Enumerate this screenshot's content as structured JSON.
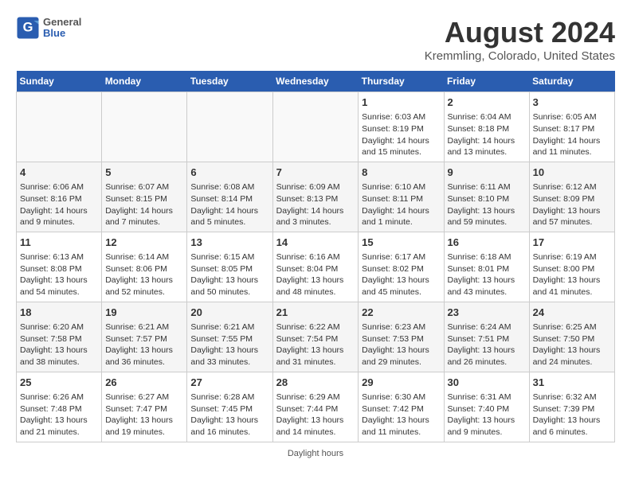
{
  "header": {
    "logo_general": "General",
    "logo_blue": "Blue",
    "month_year": "August 2024",
    "location": "Kremmling, Colorado, United States"
  },
  "days_of_week": [
    "Sunday",
    "Monday",
    "Tuesday",
    "Wednesday",
    "Thursday",
    "Friday",
    "Saturday"
  ],
  "footer": "Daylight hours",
  "weeks": [
    [
      {
        "day": "",
        "info": ""
      },
      {
        "day": "",
        "info": ""
      },
      {
        "day": "",
        "info": ""
      },
      {
        "day": "",
        "info": ""
      },
      {
        "day": "1",
        "info": "Sunrise: 6:03 AM\nSunset: 8:19 PM\nDaylight: 14 hours and 15 minutes."
      },
      {
        "day": "2",
        "info": "Sunrise: 6:04 AM\nSunset: 8:18 PM\nDaylight: 14 hours and 13 minutes."
      },
      {
        "day": "3",
        "info": "Sunrise: 6:05 AM\nSunset: 8:17 PM\nDaylight: 14 hours and 11 minutes."
      }
    ],
    [
      {
        "day": "4",
        "info": "Sunrise: 6:06 AM\nSunset: 8:16 PM\nDaylight: 14 hours and 9 minutes."
      },
      {
        "day": "5",
        "info": "Sunrise: 6:07 AM\nSunset: 8:15 PM\nDaylight: 14 hours and 7 minutes."
      },
      {
        "day": "6",
        "info": "Sunrise: 6:08 AM\nSunset: 8:14 PM\nDaylight: 14 hours and 5 minutes."
      },
      {
        "day": "7",
        "info": "Sunrise: 6:09 AM\nSunset: 8:13 PM\nDaylight: 14 hours and 3 minutes."
      },
      {
        "day": "8",
        "info": "Sunrise: 6:10 AM\nSunset: 8:11 PM\nDaylight: 14 hours and 1 minute."
      },
      {
        "day": "9",
        "info": "Sunrise: 6:11 AM\nSunset: 8:10 PM\nDaylight: 13 hours and 59 minutes."
      },
      {
        "day": "10",
        "info": "Sunrise: 6:12 AM\nSunset: 8:09 PM\nDaylight: 13 hours and 57 minutes."
      }
    ],
    [
      {
        "day": "11",
        "info": "Sunrise: 6:13 AM\nSunset: 8:08 PM\nDaylight: 13 hours and 54 minutes."
      },
      {
        "day": "12",
        "info": "Sunrise: 6:14 AM\nSunset: 8:06 PM\nDaylight: 13 hours and 52 minutes."
      },
      {
        "day": "13",
        "info": "Sunrise: 6:15 AM\nSunset: 8:05 PM\nDaylight: 13 hours and 50 minutes."
      },
      {
        "day": "14",
        "info": "Sunrise: 6:16 AM\nSunset: 8:04 PM\nDaylight: 13 hours and 48 minutes."
      },
      {
        "day": "15",
        "info": "Sunrise: 6:17 AM\nSunset: 8:02 PM\nDaylight: 13 hours and 45 minutes."
      },
      {
        "day": "16",
        "info": "Sunrise: 6:18 AM\nSunset: 8:01 PM\nDaylight: 13 hours and 43 minutes."
      },
      {
        "day": "17",
        "info": "Sunrise: 6:19 AM\nSunset: 8:00 PM\nDaylight: 13 hours and 41 minutes."
      }
    ],
    [
      {
        "day": "18",
        "info": "Sunrise: 6:20 AM\nSunset: 7:58 PM\nDaylight: 13 hours and 38 minutes."
      },
      {
        "day": "19",
        "info": "Sunrise: 6:21 AM\nSunset: 7:57 PM\nDaylight: 13 hours and 36 minutes."
      },
      {
        "day": "20",
        "info": "Sunrise: 6:21 AM\nSunset: 7:55 PM\nDaylight: 13 hours and 33 minutes."
      },
      {
        "day": "21",
        "info": "Sunrise: 6:22 AM\nSunset: 7:54 PM\nDaylight: 13 hours and 31 minutes."
      },
      {
        "day": "22",
        "info": "Sunrise: 6:23 AM\nSunset: 7:53 PM\nDaylight: 13 hours and 29 minutes."
      },
      {
        "day": "23",
        "info": "Sunrise: 6:24 AM\nSunset: 7:51 PM\nDaylight: 13 hours and 26 minutes."
      },
      {
        "day": "24",
        "info": "Sunrise: 6:25 AM\nSunset: 7:50 PM\nDaylight: 13 hours and 24 minutes."
      }
    ],
    [
      {
        "day": "25",
        "info": "Sunrise: 6:26 AM\nSunset: 7:48 PM\nDaylight: 13 hours and 21 minutes."
      },
      {
        "day": "26",
        "info": "Sunrise: 6:27 AM\nSunset: 7:47 PM\nDaylight: 13 hours and 19 minutes."
      },
      {
        "day": "27",
        "info": "Sunrise: 6:28 AM\nSunset: 7:45 PM\nDaylight: 13 hours and 16 minutes."
      },
      {
        "day": "28",
        "info": "Sunrise: 6:29 AM\nSunset: 7:44 PM\nDaylight: 13 hours and 14 minutes."
      },
      {
        "day": "29",
        "info": "Sunrise: 6:30 AM\nSunset: 7:42 PM\nDaylight: 13 hours and 11 minutes."
      },
      {
        "day": "30",
        "info": "Sunrise: 6:31 AM\nSunset: 7:40 PM\nDaylight: 13 hours and 9 minutes."
      },
      {
        "day": "31",
        "info": "Sunrise: 6:32 AM\nSunset: 7:39 PM\nDaylight: 13 hours and 6 minutes."
      }
    ]
  ]
}
